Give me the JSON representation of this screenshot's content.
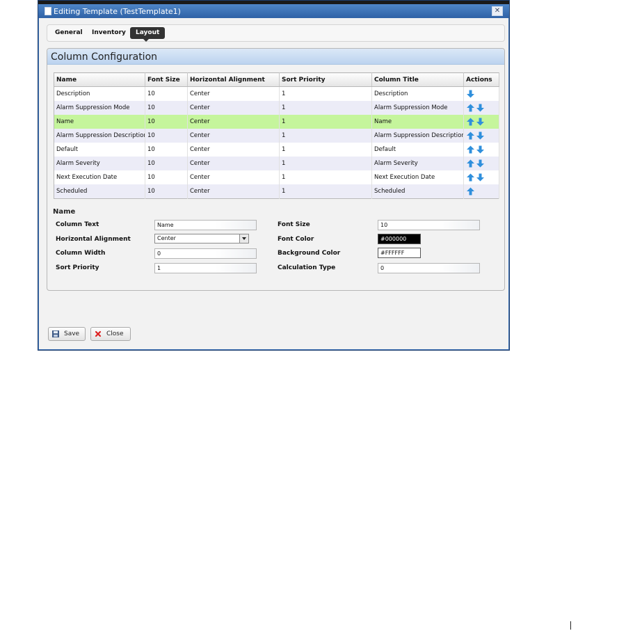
{
  "window": {
    "title": "Editing Template (TestTemplate1)",
    "close_glyph": "✕"
  },
  "tabs": [
    {
      "label": "General"
    },
    {
      "label": "Inventory"
    },
    {
      "label": "Layout",
      "active": true
    }
  ],
  "panel": {
    "title": "Column Configuration"
  },
  "table": {
    "headers": [
      "Name",
      "Font Size",
      "Horizontal Alignment",
      "Sort Priority",
      "Column Title",
      "Actions"
    ],
    "rows": [
      {
        "name": "Description",
        "font_size": "10",
        "align": "Center",
        "sort": "1",
        "title": "Description",
        "actions": [
          "down"
        ]
      },
      {
        "name": "Alarm Suppression Mode",
        "font_size": "10",
        "align": "Center",
        "sort": "1",
        "title": "Alarm Suppression Mode",
        "actions": [
          "up",
          "down"
        ]
      },
      {
        "name": "Name",
        "font_size": "10",
        "align": "Center",
        "sort": "1",
        "title": "Name",
        "actions": [
          "up",
          "down"
        ],
        "selected": true
      },
      {
        "name": "Alarm Suppression Description",
        "font_size": "10",
        "align": "Center",
        "sort": "1",
        "title": "Alarm Suppression Description",
        "actions": [
          "up",
          "down"
        ]
      },
      {
        "name": "Default",
        "font_size": "10",
        "align": "Center",
        "sort": "1",
        "title": "Default",
        "actions": [
          "up",
          "down"
        ]
      },
      {
        "name": "Alarm Severity",
        "font_size": "10",
        "align": "Center",
        "sort": "1",
        "title": "Alarm Severity",
        "actions": [
          "up",
          "down"
        ]
      },
      {
        "name": "Next Execution Date",
        "font_size": "10",
        "align": "Center",
        "sort": "1",
        "title": "Next Execution Date",
        "actions": [
          "up",
          "down"
        ]
      },
      {
        "name": "Scheduled",
        "font_size": "10",
        "align": "Center",
        "sort": "1",
        "title": "Scheduled",
        "actions": [
          "up"
        ]
      }
    ]
  },
  "detail": {
    "title": "Name",
    "column_text_label": "Column Text",
    "column_text_value": "Name",
    "horizontal_alignment_label": "Horizontal Alignment",
    "horizontal_alignment_value": "Center",
    "column_width_label": "Column Width",
    "column_width_value": "0",
    "sort_priority_label": "Sort Priority",
    "sort_priority_value": "1",
    "font_size_label": "Font Size",
    "font_size_value": "10",
    "font_color_label": "Font Color",
    "font_color_value": "#000000",
    "background_color_label": "Background Color",
    "background_color_value": "#FFFFFF",
    "calculation_type_label": "Calculation Type",
    "calculation_type_value": "0"
  },
  "buttons": {
    "save_label": "Save",
    "close_label": "Close"
  },
  "colors": {
    "selected_row": "#c5f59c",
    "alt_row": "#ececf7",
    "arrow_blue": "#2f8fdc",
    "titlebar": "#3b6fb3"
  },
  "icons": {
    "up": "arrow-up-icon",
    "down": "arrow-down-icon",
    "save": "floppy-disk-icon",
    "close": "red-x-icon"
  }
}
